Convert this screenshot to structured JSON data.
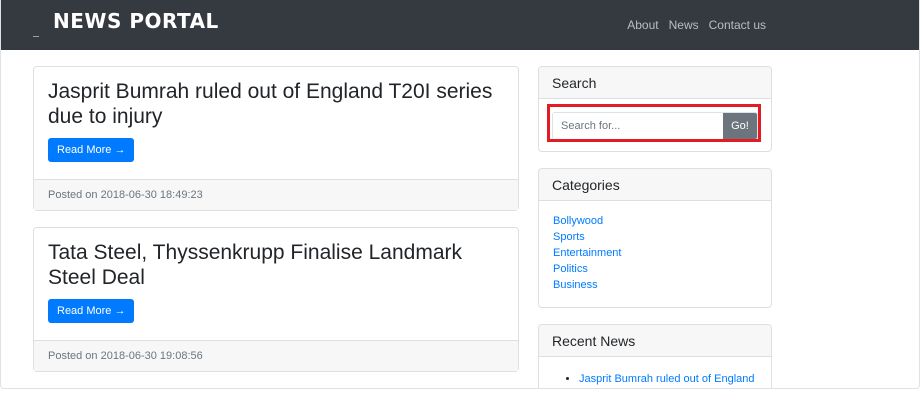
{
  "navbar": {
    "brand": "NEWS PORTAL",
    "links": [
      "About",
      "News",
      "Contact us"
    ]
  },
  "posts": [
    {
      "title": "Jasprit Bumrah ruled out of England T20I series due to injury",
      "button": "Read More →",
      "posted": "Posted on 2018-06-30 18:49:23"
    },
    {
      "title": "Tata Steel, Thyssenkrupp Finalise Landmark Steel Deal",
      "button": "Read More →",
      "posted": "Posted on 2018-06-30 19:08:56"
    }
  ],
  "sidebar": {
    "search": {
      "title": "Search",
      "placeholder": "Search for...",
      "button": "Go!"
    },
    "categories": {
      "title": "Categories",
      "items": [
        "Bollywood",
        "Sports",
        "Entertainment",
        "Politics",
        "Business"
      ]
    },
    "recent": {
      "title": "Recent News",
      "items": [
        "Jasprit Bumrah ruled out of England"
      ]
    }
  },
  "colors": {
    "navbar": "#343a40",
    "primary": "#007bff",
    "secondary": "#6c757d",
    "highlight": "#e31b23"
  }
}
